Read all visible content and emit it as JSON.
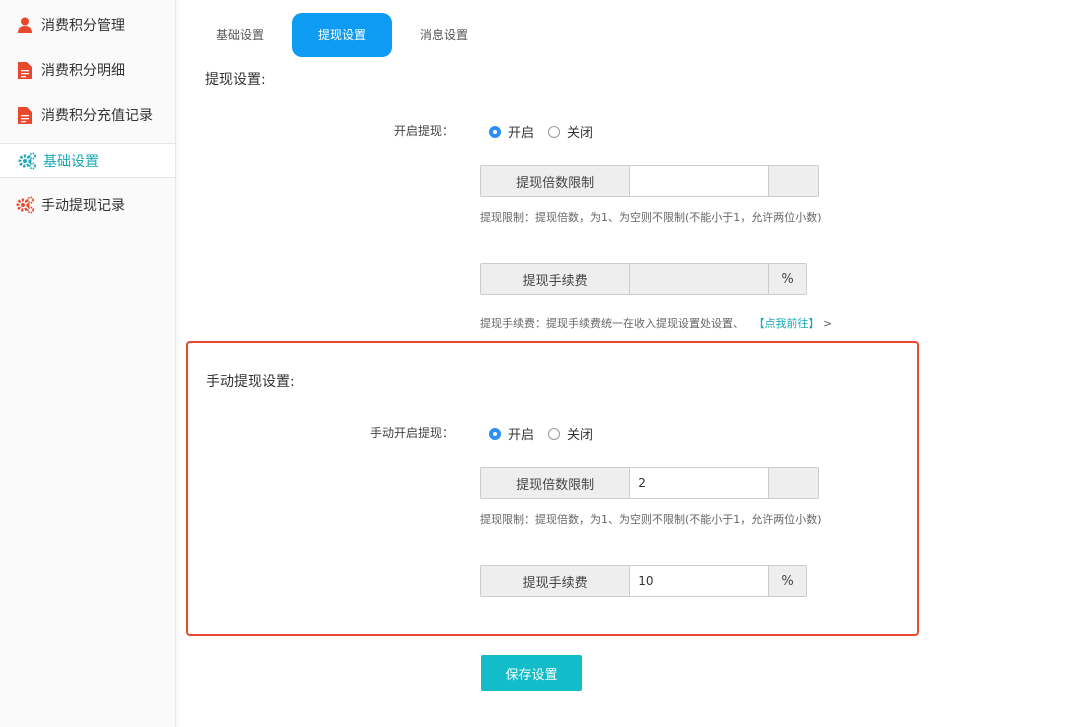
{
  "sidebar": {
    "items": [
      {
        "label": "消费积分管理",
        "icon": "user-icon"
      },
      {
        "label": "消费积分明细",
        "icon": "document-icon"
      },
      {
        "label": "消费积分充值记录",
        "icon": "document-icon"
      },
      {
        "label": "基础设置",
        "icon": "gears-icon"
      },
      {
        "label": "手动提现记录",
        "icon": "gears-icon"
      }
    ]
  },
  "tabs": [
    {
      "label": "基础设置"
    },
    {
      "label": "提现设置"
    },
    {
      "label": "消息设置"
    }
  ],
  "withdraw": {
    "title": "提现设置:",
    "enable_label": "开启提现：",
    "enable_options": [
      "开启",
      "关闭"
    ],
    "enable_selected": "开启",
    "multiple_label": "提现倍数限制",
    "multiple_value": "",
    "multiple_hint": "提现限制：提现倍数，为1、为空则不限制(不能小于1，允许两位小数)",
    "fee_label": "提现手续费",
    "fee_value": "",
    "fee_unit": "%",
    "fee_hint": "提现手续费：提现手续费统一在收入提现设置处设置、",
    "fee_link": "【点我前往】",
    "fee_arrow": ">"
  },
  "manual": {
    "title": "手动提现设置:",
    "enable_label": "手动开启提现：",
    "enable_options": [
      "开启",
      "关闭"
    ],
    "enable_selected": "开启",
    "multiple_label": "提现倍数限制",
    "multiple_value": "2",
    "multiple_hint": "提现限制：提现倍数，为1、为空则不限制(不能小于1，允许两位小数)",
    "fee_label": "提现手续费",
    "fee_value": "10",
    "fee_unit": "%"
  },
  "save_label": "保存设置",
  "colors": {
    "accent": "#0d9bf4",
    "teal": "#12bcc9",
    "highlight_border": "#e8482c",
    "icon_red": "#e8482c"
  }
}
